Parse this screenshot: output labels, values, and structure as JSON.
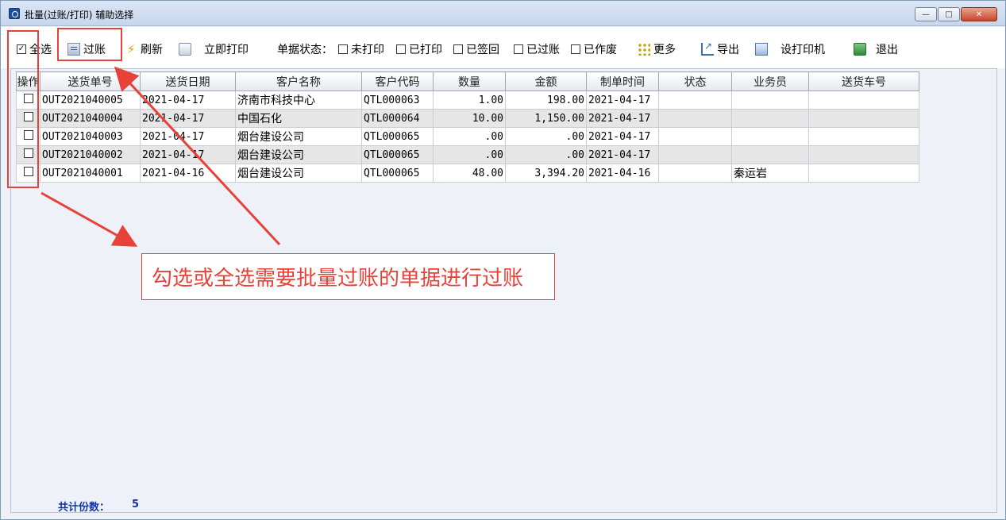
{
  "window": {
    "title": "批量(过账/打印) 辅助选择",
    "buttons": {
      "minimize": "—",
      "maximize": "□",
      "close": "✕"
    }
  },
  "toolbar": {
    "select_all_label": "全选",
    "select_all_checked": true,
    "post_label": "过账",
    "refresh_label": "刷新",
    "print_now_label": "立即打印",
    "status_label": "单据状态：",
    "status_filters": [
      {
        "label": "未打印",
        "checked": false
      },
      {
        "label": "已打印",
        "checked": false
      },
      {
        "label": "已签回",
        "checked": false
      },
      {
        "label": "已过账",
        "checked": false
      },
      {
        "label": "已作废",
        "checked": false
      }
    ],
    "more_label": "更多",
    "export_label": "导出",
    "printer_setup_label": "设打印机",
    "exit_label": "退出"
  },
  "grid": {
    "columns": [
      "操作",
      "送货单号",
      "送货日期",
      "客户名称",
      "客户代码",
      "数量",
      "金额",
      "制单时间",
      "状态",
      "业务员",
      "送货车号"
    ],
    "rows": [
      {
        "order_no": "OUT2021040005",
        "date": "2021-04-17",
        "customer": "济南市科技中心",
        "code": "QTL000063",
        "qty": "1.00",
        "amount": "198.00",
        "created": "2021-04-17",
        "status": "",
        "salesman": "",
        "truck": ""
      },
      {
        "order_no": "OUT2021040004",
        "date": "2021-04-17",
        "customer": "中国石化",
        "code": "QTL000064",
        "qty": "10.00",
        "amount": "1,150.00",
        "created": "2021-04-17",
        "status": "",
        "salesman": "",
        "truck": ""
      },
      {
        "order_no": "OUT2021040003",
        "date": "2021-04-17",
        "customer": "烟台建设公司",
        "code": "QTL000065",
        "qty": ".00",
        "amount": ".00",
        "created": "2021-04-17",
        "status": "",
        "salesman": "",
        "truck": ""
      },
      {
        "order_no": "OUT2021040002",
        "date": "2021-04-17",
        "customer": "烟台建设公司",
        "code": "QTL000065",
        "qty": ".00",
        "amount": ".00",
        "created": "2021-04-17",
        "status": "",
        "salesman": "",
        "truck": ""
      },
      {
        "order_no": "OUT2021040001",
        "date": "2021-04-16",
        "customer": "烟台建设公司",
        "code": "QTL000065",
        "qty": "48.00",
        "amount": "3,394.20",
        "created": "2021-04-16",
        "status": "",
        "salesman": "秦运岩",
        "truck": ""
      }
    ]
  },
  "callout": {
    "text": "勾选或全选需要批量过账的单据进行过账"
  },
  "footer": {
    "total_label": "共计份数：",
    "total_value": "5"
  },
  "colors": {
    "annotation_red": "#e8413a",
    "footer_blue": "#1233a8"
  }
}
